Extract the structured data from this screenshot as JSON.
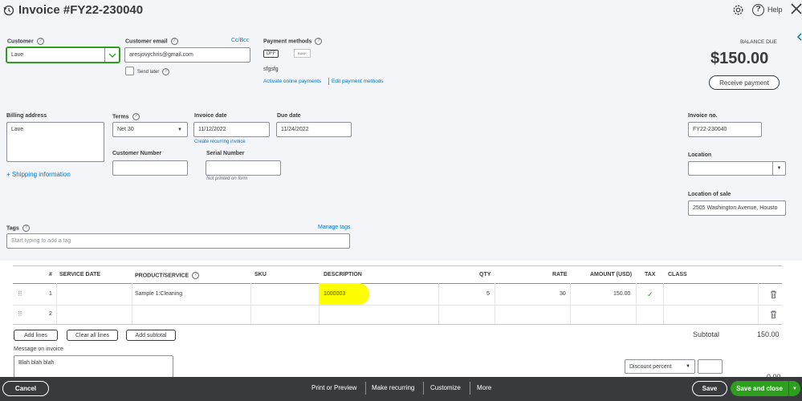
{
  "header": {
    "title": "Invoice #FY22-230040",
    "help_label": "Help"
  },
  "customer": {
    "label": "Customer",
    "value": "Lave"
  },
  "email": {
    "label": "Customer email",
    "value": "aresjovychris@gmail.com",
    "cc_bcc": "Cc/Bcc",
    "send_later": "Send later"
  },
  "payment": {
    "label": "Payment methods",
    "toggle": "OFF",
    "bank": "BANK",
    "note": "sfgsfg",
    "activate_link": "Activate online payments",
    "edit_link": "Edit payment methods"
  },
  "balance": {
    "label": "BALANCE DUE",
    "amount": "$150.00",
    "receive_button": "Receive payment"
  },
  "billing": {
    "label": "Billing address",
    "value": "Lave",
    "shipping_link": "+ Shipping information"
  },
  "terms": {
    "label": "Terms",
    "value": "Net 30"
  },
  "invoice_date": {
    "label": "Invoice date",
    "value": "11/12/2022",
    "recurring_link": "Create recurring invoice"
  },
  "due_date": {
    "label": "Due date",
    "value": "11/24/2022"
  },
  "customer_number": {
    "label": "Customer Number",
    "value": ""
  },
  "serial_number": {
    "label": "Serial Number",
    "value": "",
    "note": "Not printed on form"
  },
  "invoice_no": {
    "label": "Invoice no.",
    "value": "FY22-230040"
  },
  "location": {
    "label": "Location",
    "value": ""
  },
  "location_of_sale": {
    "label": "Location of sale",
    "value": "2505 Washington Avenue, Housto"
  },
  "tags": {
    "label": "Tags",
    "manage_link": "Manage tags",
    "placeholder": "Start typing to add a tag"
  },
  "table": {
    "columns": {
      "num": "#",
      "service_date": "SERVICE DATE",
      "product": "PRODUCT/SERVICE",
      "sku": "SKU",
      "description": "DESCRIPTION",
      "qty": "QTY",
      "rate": "RATE",
      "amount": "AMOUNT (USD)",
      "tax": "TAX",
      "class": "CLASS"
    },
    "rows": [
      {
        "num": "1",
        "product": "Sample 1:Cleaning",
        "description": "1000003",
        "qty": "5",
        "rate": "30",
        "amount": "150.00",
        "tax": "✓"
      },
      {
        "num": "2",
        "product": "",
        "description": "",
        "qty": "",
        "rate": "",
        "amount": "",
        "tax": ""
      }
    ]
  },
  "line_buttons": {
    "add_lines": "Add lines",
    "clear_all": "Clear all lines",
    "add_subtotal": "Add subtotal"
  },
  "subtotal": {
    "label": "Subtotal",
    "value": "150.00"
  },
  "message": {
    "label": "Message on invoice",
    "value": "Blah blah blah"
  },
  "discount": {
    "type": "Discount percent",
    "value": "",
    "amount": "0.00"
  },
  "footer": {
    "cancel": "Cancel",
    "print_preview": "Print or Preview",
    "make_recurring": "Make recurring",
    "customize": "Customize",
    "more": "More",
    "save": "Save",
    "save_close": "Save and close"
  },
  "colors": {
    "accent_green": "#2ca01c",
    "link_blue": "#0077c5",
    "highlight_yellow": "#ffff00",
    "footer_dark": "#393a3d"
  }
}
